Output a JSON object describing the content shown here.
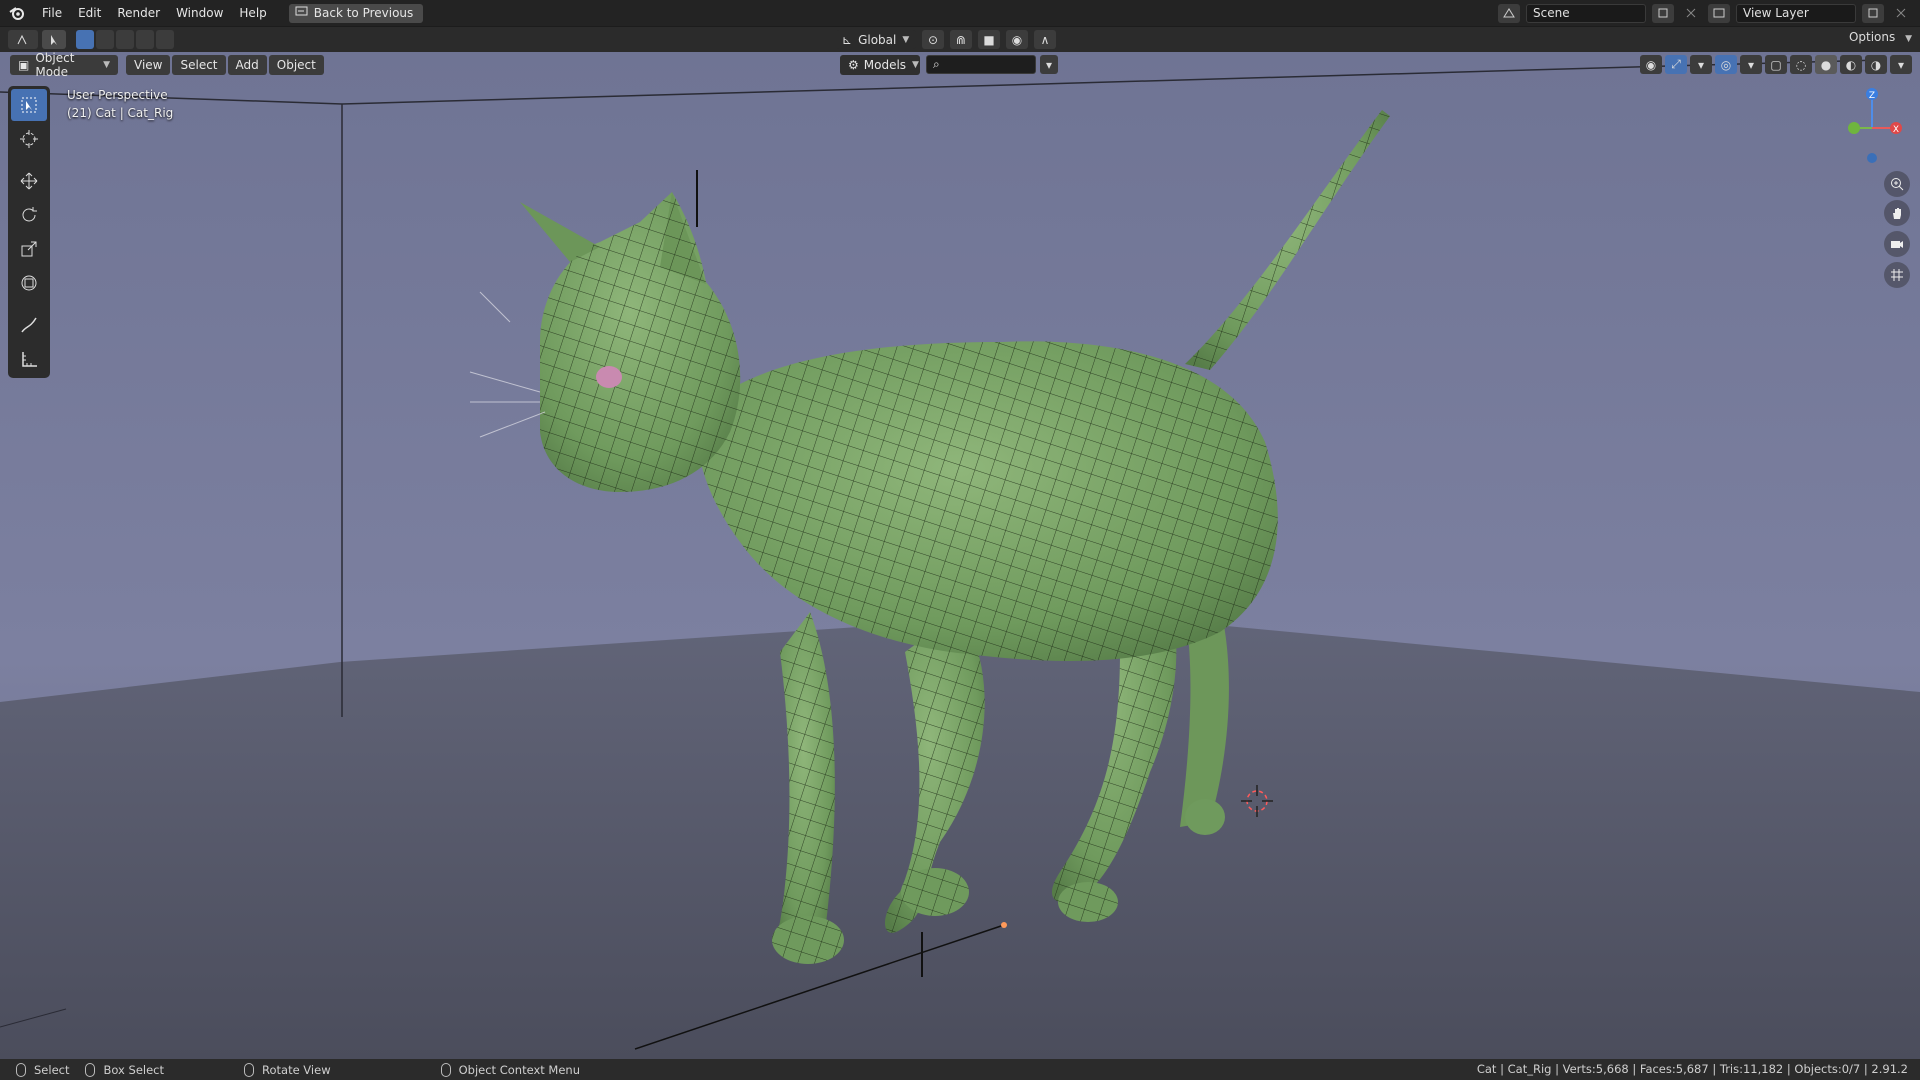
{
  "menubar": {
    "items": [
      "File",
      "Edit",
      "Render",
      "Window",
      "Help"
    ],
    "back_button": "Back to Previous"
  },
  "topbar_right": {
    "scene": "Scene",
    "view_layer": "View Layer"
  },
  "toolbar": {
    "orientation": "Global",
    "options_label": "Options"
  },
  "viewport_header": {
    "mode": "Object Mode",
    "menus": [
      "View",
      "Select",
      "Add",
      "Object"
    ],
    "collection": "Models",
    "search_placeholder": ""
  },
  "viewport_overlay": {
    "view_name": "User Perspective",
    "object_info": "(21) Cat | Cat_Rig"
  },
  "statusbar": {
    "left_items": [
      "Select",
      "Box Select",
      "Rotate View",
      "Object Context Menu"
    ],
    "right_text": "Cat | Cat_Rig | Verts:5,668 | Faces:5,687 | Tris:11,182 | Objects:0/7 | 2.91.2"
  },
  "gizmo": {
    "axis_z": "Z",
    "axis_x": "X"
  },
  "colors": {
    "accent": "#4772b3",
    "mesh_green": "#7fa86a",
    "viewport_bg_top": "#767a99",
    "floor": "#5b5e72"
  }
}
